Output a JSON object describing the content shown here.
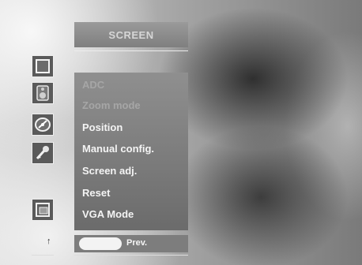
{
  "header": {
    "title": "SCREEN"
  },
  "sidebar": {
    "icons": [
      {
        "name": "picture-frame-icon"
      },
      {
        "name": "speaker-icon"
      },
      {
        "name": "clock-icon"
      },
      {
        "name": "key-icon"
      },
      {
        "name": "screen-icon"
      }
    ]
  },
  "menu": {
    "items": [
      {
        "label": "ADC",
        "state": "dim"
      },
      {
        "label": "Zoom mode",
        "state": "dim"
      },
      {
        "label": "Position",
        "state": "normal"
      },
      {
        "label": "Manual config.",
        "state": "normal"
      },
      {
        "label": "Screen adj.",
        "state": "normal"
      },
      {
        "label": "Reset",
        "state": "normal"
      },
      {
        "label": "VGA Mode",
        "state": "normal"
      }
    ]
  },
  "footer": {
    "prev_label": "Prev.",
    "arrow": "↑"
  }
}
